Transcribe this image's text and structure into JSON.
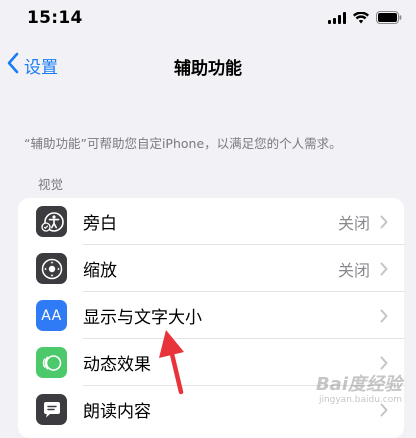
{
  "status_bar": {
    "time": "15:14"
  },
  "nav": {
    "back_label": "设置",
    "title": "辅助功能"
  },
  "description": "“辅助功能”可帮助您自定iPhone，以满足您的个人需求。",
  "section": {
    "header": "视觉"
  },
  "rows": [
    {
      "label": "旁白",
      "value": "关闭",
      "icon": "accessibility-voiceover-icon"
    },
    {
      "label": "缩放",
      "value": "关闭",
      "icon": "zoom-icon"
    },
    {
      "label": "显示与文字大小",
      "value": "",
      "icon": "text-size-icon",
      "icon_text": "AA"
    },
    {
      "label": "动态效果",
      "value": "",
      "icon": "motion-icon"
    },
    {
      "label": "朗读内容",
      "value": "",
      "icon": "speech-bubble-icon"
    }
  ],
  "colors": {
    "accent": "#1a7cf5",
    "icon_dark": "#3c3c40",
    "icon_blue": "#2f7bf5",
    "icon_green": "#4cc96a",
    "annotation_arrow": "#e8333b"
  },
  "watermark": {
    "main": "Bai度经验",
    "sub": "jingyan.baidu.com"
  }
}
